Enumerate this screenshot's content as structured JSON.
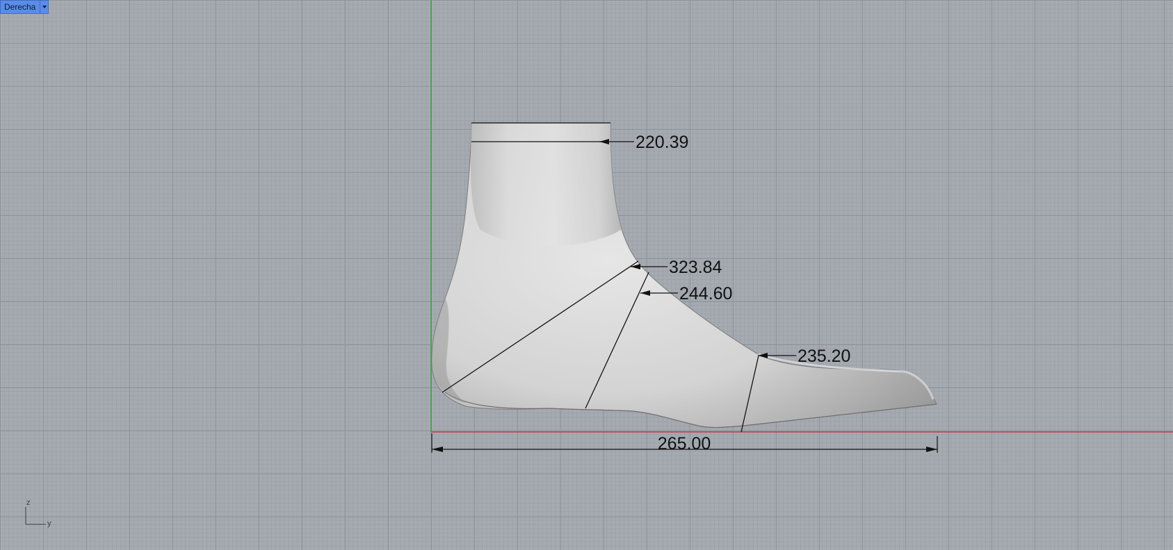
{
  "viewport": {
    "name": "Derecha"
  },
  "colors": {
    "grid_background": "#a6abb2",
    "x_axis": "#c2262c",
    "y_axis": "#2ca02c",
    "viewport_tab": "#5b8de6"
  },
  "dimensions": {
    "top_circumference": "220.39",
    "instep_circumference": "323.84",
    "waist_circumference": "244.60",
    "ball_circumference": "235.20",
    "overall_length": "265.00"
  },
  "axis_indicator": {
    "vertical": "z",
    "horizontal": "y"
  },
  "icons": {
    "viewport_menu": "chevron-down-icon",
    "axis_gizmo": "axis-gizmo-icon"
  }
}
